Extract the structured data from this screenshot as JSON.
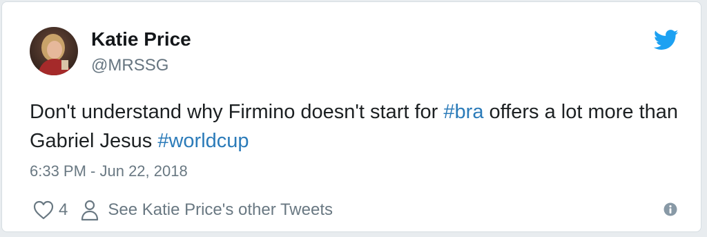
{
  "tweet": {
    "author_name": "Katie Price",
    "author_handle": "@MRSSG",
    "text_parts": [
      "Don't understand why Firmino doesn't start for ",
      "#bra",
      " offers a lot more than Gabriel Jesus ",
      "#worldcup"
    ],
    "timestamp": "6:33 PM - Jun 22, 2018",
    "likes_count": "4",
    "other_tweets_label": "See Katie Price's other Tweets"
  },
  "icons": {
    "brand": "twitter-bird-icon",
    "like": "heart-icon",
    "profile": "person-icon",
    "info": "info-icon"
  },
  "colors": {
    "brand": "#1da1f2",
    "hashtag": "#2b7bb9",
    "text": "#1c2022",
    "muted": "#697882"
  }
}
